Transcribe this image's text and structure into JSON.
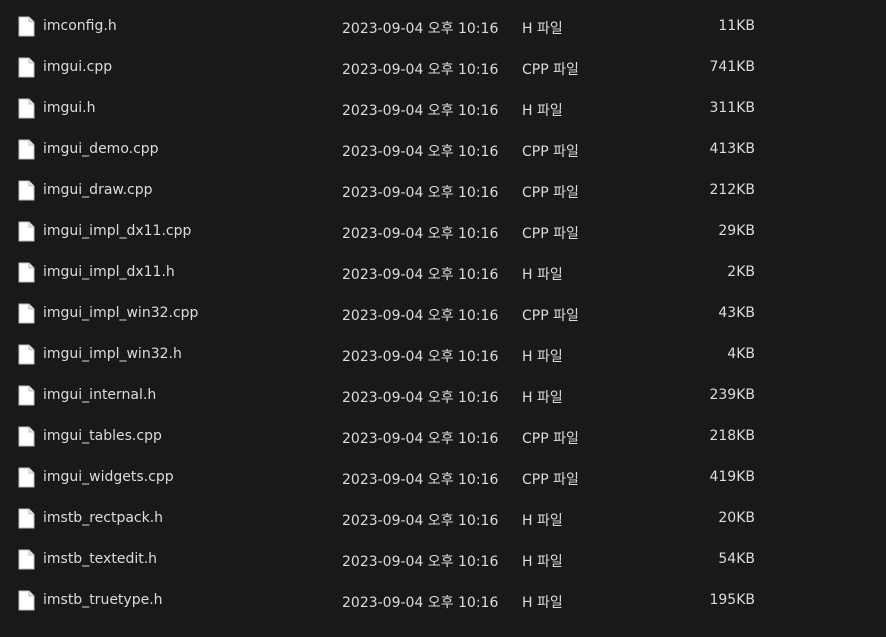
{
  "files": [
    {
      "name": "imconfig.h",
      "modified": "2023-09-04 오후 10:16",
      "type": "H 파일",
      "size": "11KB",
      "icon": "document-icon"
    },
    {
      "name": "imgui.cpp",
      "modified": "2023-09-04 오후 10:16",
      "type": "CPP 파일",
      "size": "741KB",
      "icon": "document-icon"
    },
    {
      "name": "imgui.h",
      "modified": "2023-09-04 오후 10:16",
      "type": "H 파일",
      "size": "311KB",
      "icon": "document-icon"
    },
    {
      "name": "imgui_demo.cpp",
      "modified": "2023-09-04 오후 10:16",
      "type": "CPP 파일",
      "size": "413KB",
      "icon": "document-icon"
    },
    {
      "name": "imgui_draw.cpp",
      "modified": "2023-09-04 오후 10:16",
      "type": "CPP 파일",
      "size": "212KB",
      "icon": "document-icon"
    },
    {
      "name": "imgui_impl_dx11.cpp",
      "modified": "2023-09-04 오후 10:16",
      "type": "CPP 파일",
      "size": "29KB",
      "icon": "document-icon"
    },
    {
      "name": "imgui_impl_dx11.h",
      "modified": "2023-09-04 오후 10:16",
      "type": "H 파일",
      "size": "2KB",
      "icon": "document-icon"
    },
    {
      "name": "imgui_impl_win32.cpp",
      "modified": "2023-09-04 오후 10:16",
      "type": "CPP 파일",
      "size": "43KB",
      "icon": "document-icon"
    },
    {
      "name": "imgui_impl_win32.h",
      "modified": "2023-09-04 오후 10:16",
      "type": "H 파일",
      "size": "4KB",
      "icon": "document-icon"
    },
    {
      "name": "imgui_internal.h",
      "modified": "2023-09-04 오후 10:16",
      "type": "H 파일",
      "size": "239KB",
      "icon": "document-icon"
    },
    {
      "name": "imgui_tables.cpp",
      "modified": "2023-09-04 오후 10:16",
      "type": "CPP 파일",
      "size": "218KB",
      "icon": "document-icon"
    },
    {
      "name": "imgui_widgets.cpp",
      "modified": "2023-09-04 오후 10:16",
      "type": "CPP 파일",
      "size": "419KB",
      "icon": "document-icon"
    },
    {
      "name": "imstb_rectpack.h",
      "modified": "2023-09-04 오후 10:16",
      "type": "H 파일",
      "size": "20KB",
      "icon": "document-icon"
    },
    {
      "name": "imstb_textedit.h",
      "modified": "2023-09-04 오후 10:16",
      "type": "H 파일",
      "size": "54KB",
      "icon": "document-icon"
    },
    {
      "name": "imstb_truetype.h",
      "modified": "2023-09-04 오후 10:16",
      "type": "H 파일",
      "size": "195KB",
      "icon": "document-icon"
    }
  ],
  "colors": {
    "background": "#191919",
    "text": "#dcdcdc",
    "icon_fill": "#ffffff"
  }
}
